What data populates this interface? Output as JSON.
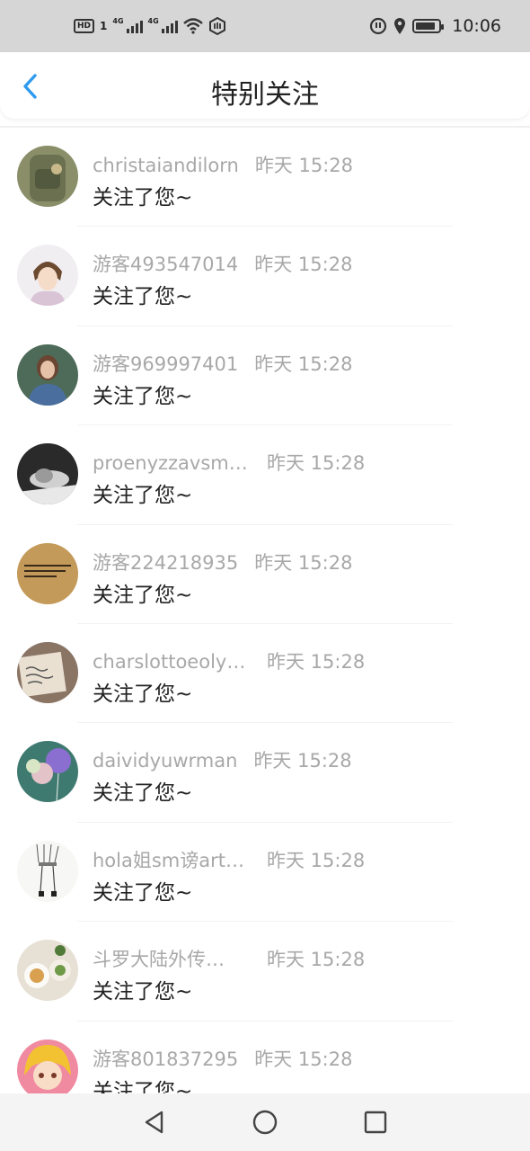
{
  "status_bar": {
    "time": "10:06",
    "hd_label": "HD",
    "sim1_network": "4G",
    "sim2_network": "4G",
    "sim_number": "1",
    "battery_level": 0.85,
    "icons": [
      "hd-icon",
      "signal-icon",
      "signal-icon",
      "wifi-icon",
      "hand-icon",
      "alarm-icon",
      "location-icon",
      "battery-icon"
    ]
  },
  "header": {
    "title": "特别关注",
    "accent": "#2e9bf0"
  },
  "list": {
    "items": [
      {
        "name": "christaiandilorn",
        "time": "昨天 15:28",
        "message": "关注了您~",
        "avatar": "backpack"
      },
      {
        "name": "游客493547014",
        "time": "昨天 15:28",
        "message": "关注了您~",
        "avatar": "anime-boy"
      },
      {
        "name": "游客969997401",
        "time": "昨天 15:28",
        "message": "关注了您~",
        "avatar": "girl-denim"
      },
      {
        "name": "proenyzzavsm…",
        "time": "昨天 15:28",
        "message": "关注了您~",
        "avatar": "bw-portrait"
      },
      {
        "name": "游客224218935",
        "time": "昨天 15:28",
        "message": "关注了您~",
        "avatar": "text-card"
      },
      {
        "name": "charslottoeoly…",
        "time": "昨天 15:28",
        "message": "关注了您~",
        "avatar": "handwriting"
      },
      {
        "name": "daividyuwrman",
        "time": "昨天 15:28",
        "message": "关注了您~",
        "avatar": "balloons"
      },
      {
        "name": "hola姐sm谤art…",
        "time": "昨天 15:28",
        "message": "关注了您~",
        "avatar": "sketch"
      },
      {
        "name": "斗罗大陆外传…",
        "time": "昨天 15:28",
        "message": "关注了您~",
        "avatar": "food"
      },
      {
        "name": "游客801837295",
        "time": "昨天 15:28",
        "message": "关注了您~",
        "avatar": "anime-girl"
      }
    ]
  },
  "nav_bar": {
    "buttons": [
      "back-triangle-icon",
      "home-circle-icon",
      "recents-square-icon"
    ]
  }
}
